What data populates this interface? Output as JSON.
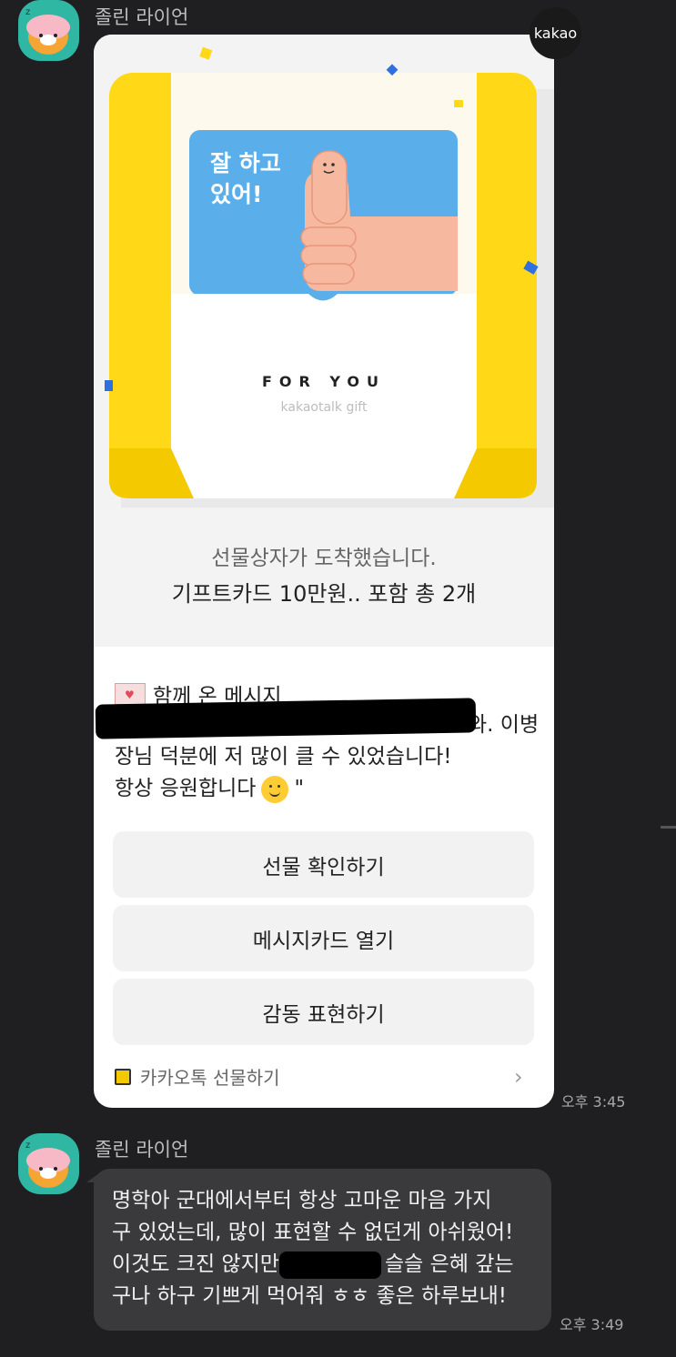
{
  "messages": [
    {
      "sender": "졸린 라이언",
      "card": {
        "badge": "kakao",
        "box_top_text": "FOR YOU",
        "box_bottom_text": "kakaotalk gift",
        "card_slogan": "잘 하고\n있어!",
        "arrive_text": "선물상자가 도착했습니다.",
        "gift_text": "기프트카드 10만원.. 포함 총 2개",
        "message_title": "함께 온 메시지",
        "message_lines": [
          "",
          "장님 덕분에 저 많이 클 수 있었습니다!",
          "항상 응원합니다"
        ],
        "message_line1_visible": "와. 이병",
        "message_end": "\"",
        "buttons": [
          "선물 확인하기",
          "메시지카드 열기",
          "감동 표현하기"
        ],
        "footer": "카카오톡 선물하기"
      },
      "time": "오후 3:45"
    },
    {
      "sender": "졸린 라이언",
      "lines": [
        "명학아 군대에서부터 항상 고마운 마음 가지",
        "구 있었는데, 많이 표현할 수 없던게 아쉬웠어!",
        "이것도 크진 않지만",
        "슬슬 은혜 갚는",
        "구나 하구 기쁘게 먹어줘 ㅎㅎ 좋은 하루보내!"
      ],
      "time": "오후 3:49"
    }
  ],
  "colors": {
    "background": "#1f1f21",
    "box_yellow": "#ffdb22",
    "card_blue": "#5aaeea",
    "bubble": "#3a3a3c"
  }
}
